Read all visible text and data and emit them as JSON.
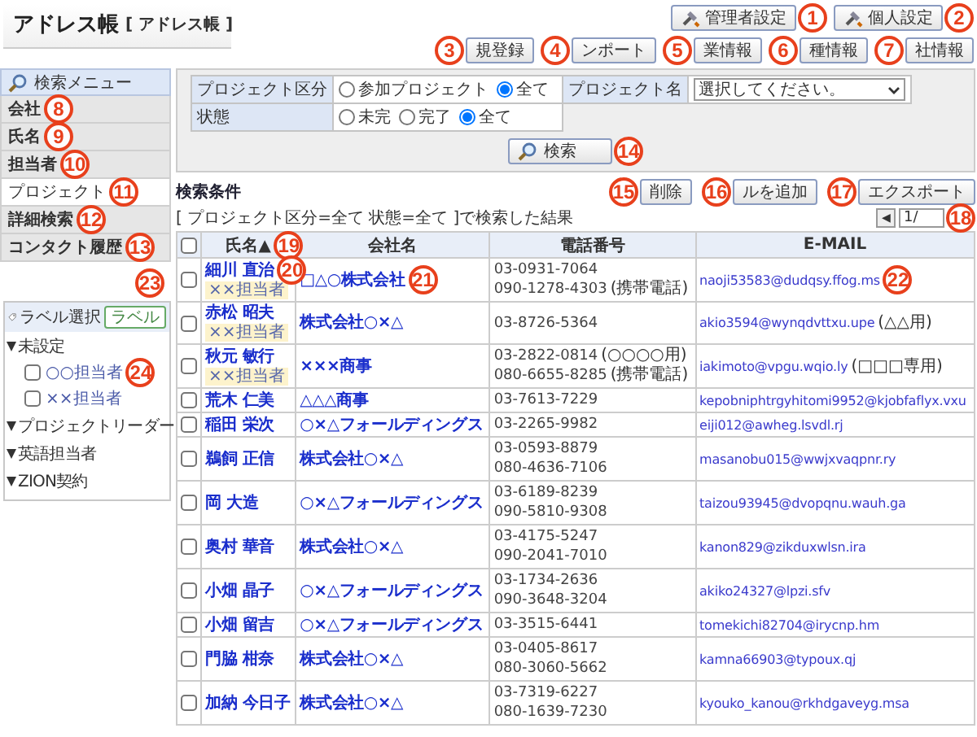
{
  "header": {
    "title": "アドレス帳",
    "subtitle": "[ アドレス帳 ]",
    "admin_buttons": [
      {
        "label": "管理者設定",
        "callout": "1"
      },
      {
        "label": "個人設定",
        "callout": "2"
      }
    ],
    "action_buttons": [
      {
        "label": "規登録",
        "callout": "3"
      },
      {
        "label": "ンポート",
        "callout": "4"
      },
      {
        "label": "業情報",
        "callout": "5"
      },
      {
        "label": "種情報",
        "callout": "6"
      },
      {
        "label": "社情報",
        "callout": "7"
      }
    ]
  },
  "sidebar": {
    "menu_title": "検索メニュー",
    "items": [
      {
        "label": "会社",
        "selected": false,
        "callout": "8"
      },
      {
        "label": "氏名",
        "selected": false,
        "callout": "9"
      },
      {
        "label": "担当者",
        "selected": false,
        "callout": "10"
      },
      {
        "label": "プロジェクト",
        "selected": true,
        "callout": "11"
      },
      {
        "label": "詳細検索",
        "selected": false,
        "callout": "12"
      },
      {
        "label": "コンタクト履歴",
        "selected": false,
        "callout": "13"
      }
    ],
    "label_panel": {
      "title": "ラベル選択",
      "button": {
        "label": "ラベル",
        "callout": "23"
      },
      "groups": [
        {
          "label": "未設定",
          "expanded": true,
          "children": [
            {
              "label": "○○担当者",
              "checked": false,
              "callout": "24"
            },
            {
              "label": "××担当者",
              "checked": false
            }
          ]
        },
        {
          "label": "プロジェクトリーダー",
          "expanded": true
        },
        {
          "label": "英語担当者",
          "expanded": true
        },
        {
          "label": "ZION契約",
          "expanded": true
        }
      ]
    }
  },
  "search": {
    "fields": [
      {
        "label": "プロジェクト区分",
        "kind": "radio",
        "options": [
          {
            "label": "参加プロジェクト",
            "selected": false
          },
          {
            "label": "全て",
            "selected": true
          }
        ]
      },
      {
        "label": "プロジェクト名",
        "kind": "select",
        "value": "選択してください。"
      },
      {
        "label": "状態",
        "kind": "radio",
        "options": [
          {
            "label": "未完",
            "selected": false
          },
          {
            "label": "完了",
            "selected": false
          },
          {
            "label": "全て",
            "selected": true
          }
        ]
      }
    ],
    "button": {
      "label": "検索",
      "callout": "14"
    }
  },
  "results": {
    "title": "検索条件",
    "summary": "[ プロジェクト区分=全て 状態=全て ]で検索した結果",
    "buttons": [
      {
        "label": "削除",
        "callout": "15"
      },
      {
        "label": "ルを追加",
        "callout": "16"
      },
      {
        "label": "エクスポート",
        "callout": "17"
      }
    ],
    "pager": {
      "prev": "◀",
      "page": "1/",
      "callout": "18"
    },
    "table": {
      "select_all_checked": false,
      "columns": [
        {
          "label": "氏名▲",
          "callout": "19"
        },
        {
          "label": "会社名"
        },
        {
          "label": "電話番号"
        },
        {
          "label": "E-MAIL"
        }
      ],
      "rows": [
        {
          "checked": false,
          "name": "細川 直治",
          "name_callout": "20",
          "tag": "××担当者",
          "company": "□△○株式会社",
          "company_callout": "21",
          "phones": [
            {
              "number": "03-0931-7064"
            },
            {
              "number": "090-1278-4303",
              "note": "(携帯電話)"
            }
          ],
          "email": "naoji53583@dudqsy.ffog.ms",
          "email_callout": "22"
        },
        {
          "checked": false,
          "name": "赤松 昭夫",
          "tag": "××担当者",
          "company": "株式会社○×△",
          "phones": [
            {
              "number": "03-8726-5364"
            }
          ],
          "email": "akio3594@wynqdvttxu.upe",
          "email_note": "(△△用)"
        },
        {
          "checked": false,
          "name": "秋元 敏行",
          "tag": "××担当者",
          "company": "×××商事",
          "phones": [
            {
              "number": "03-2822-0814",
              "note": "(○○○○用)"
            },
            {
              "number": "080-6655-8285",
              "note": "(携帯電話)"
            }
          ],
          "email": "iakimoto@vpgu.wqio.ly",
          "email_note": "(□□□専用)"
        },
        {
          "checked": false,
          "name": "荒木 仁美",
          "company": "△△△商事",
          "phones": [
            {
              "number": "03-7613-7229"
            }
          ],
          "email": "kepobniphtrgyhitomi9952@kjobfaflyx.vxu"
        },
        {
          "checked": false,
          "name": "稲田 栄次",
          "company": "○×△フォールディングス",
          "phones": [
            {
              "number": "03-2265-9982"
            }
          ],
          "email": "eiji012@awheg.lsvdl.rj"
        },
        {
          "checked": false,
          "name": "鵜飼 正信",
          "company": "株式会社○×△",
          "phones": [
            {
              "number": "03-0593-8879"
            },
            {
              "number": "080-4636-7106"
            }
          ],
          "email": "masanobu015@wwjxvaqpnr.ry"
        },
        {
          "checked": false,
          "name": "岡 大造",
          "company": "○×△フォールディングス",
          "phones": [
            {
              "number": "03-6189-8239"
            },
            {
              "number": "090-5810-9308"
            }
          ],
          "email": "taizou93945@dvopqnu.wauh.ga"
        },
        {
          "checked": false,
          "name": "奥村 華音",
          "company": "株式会社○×△",
          "phones": [
            {
              "number": "03-4175-5247"
            },
            {
              "number": "090-2041-7010"
            }
          ],
          "email": "kanon829@zikduxwlsn.ira"
        },
        {
          "checked": false,
          "name": "小畑 晶子",
          "company": "○×△フォールディングス",
          "phones": [
            {
              "number": "03-1734-2636"
            },
            {
              "number": "090-3648-3204"
            }
          ],
          "email": "akiko24327@lpzi.sfv"
        },
        {
          "checked": false,
          "name": "小畑 留吉",
          "company": "○×△フォールディングス",
          "phones": [
            {
              "number": "03-3515-6441"
            }
          ],
          "email": "tomekichi82704@irycnp.hm"
        },
        {
          "checked": false,
          "name": "門脇 柑奈",
          "company": "株式会社○×△",
          "phones": [
            {
              "number": "03-0405-8617"
            },
            {
              "number": "080-3060-5662"
            }
          ],
          "email": "kamna66903@typoux.qj"
        },
        {
          "checked": false,
          "name": "加納 今日子",
          "company": "株式会社○×△",
          "phones": [
            {
              "number": "03-7319-6227"
            },
            {
              "number": "080-1639-7230"
            }
          ],
          "email": "kyouko_kanou@rkhdgaveyg.msa"
        }
      ]
    }
  }
}
